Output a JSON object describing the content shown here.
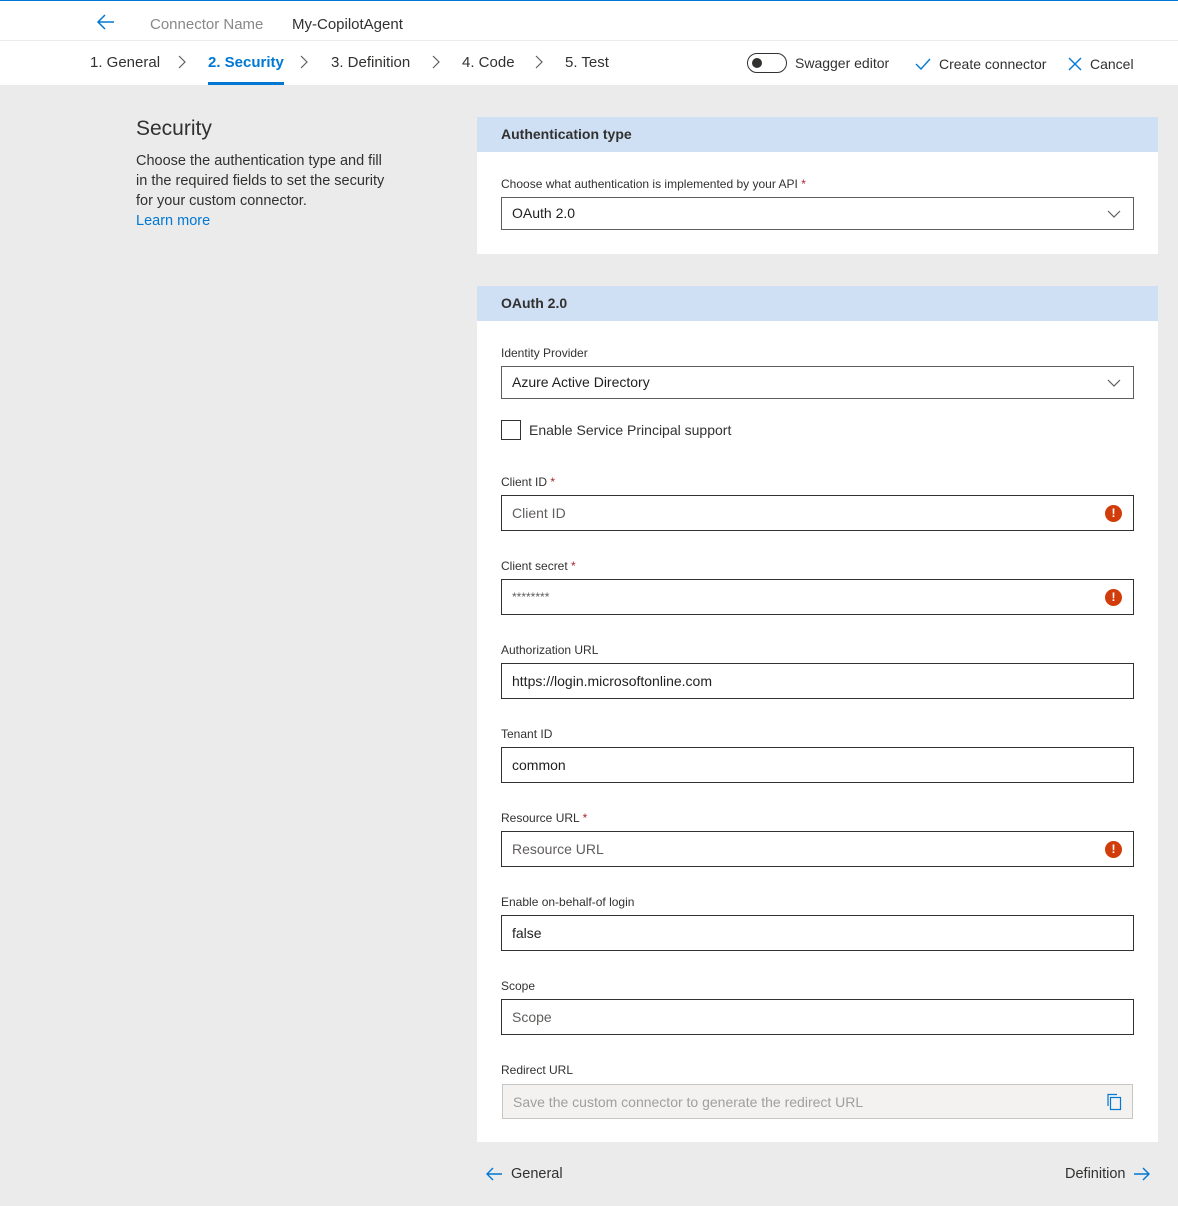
{
  "header": {
    "connector_label": "Connector Name",
    "connector_name": "My-CopilotAgent"
  },
  "steps": [
    {
      "label": "1. General"
    },
    {
      "label": "2. Security"
    },
    {
      "label": "3. Definition"
    },
    {
      "label": "4. Code"
    },
    {
      "label": "5. Test"
    }
  ],
  "toolbar": {
    "swagger_label": "Swagger editor",
    "swagger_enabled": false,
    "create_label": "Create connector",
    "cancel_label": "Cancel"
  },
  "intro": {
    "title": "Security",
    "description": "Choose the authentication type and fill in the required fields to set the security for your custom connector.",
    "learn_more": "Learn more"
  },
  "auth_card": {
    "header": "Authentication type",
    "field_label": "Choose what authentication is implemented by your API",
    "required_mark": "*",
    "value": "OAuth 2.0"
  },
  "oauth_card": {
    "header": "OAuth 2.0",
    "identity_provider": {
      "label": "Identity Provider",
      "value": "Azure Active Directory"
    },
    "service_principal": {
      "label": "Enable Service Principal support",
      "checked": false
    },
    "client_id": {
      "label": "Client ID",
      "required_mark": "*",
      "placeholder": "Client ID"
    },
    "client_secret": {
      "label": "Client secret",
      "required_mark": "*",
      "value": "********"
    },
    "authorization_url": {
      "label": "Authorization URL",
      "value": "https://login.microsoftonline.com"
    },
    "tenant_id": {
      "label": "Tenant ID",
      "value": "common"
    },
    "resource_url": {
      "label": "Resource URL",
      "required_mark": "*",
      "placeholder": "Resource URL"
    },
    "on_behalf_of": {
      "label": "Enable on-behalf-of login",
      "value": "false"
    },
    "scope": {
      "label": "Scope",
      "placeholder": "Scope"
    },
    "redirect_url": {
      "label": "Redirect URL",
      "placeholder": "Save the custom connector to generate the redirect URL"
    }
  },
  "footer": {
    "back_label": "General",
    "next_label": "Definition"
  },
  "colors": {
    "accent": "#0078d4",
    "card_header": "#cfe0f5",
    "error": "#d13c0a",
    "page_bg": "#ebebeb"
  }
}
